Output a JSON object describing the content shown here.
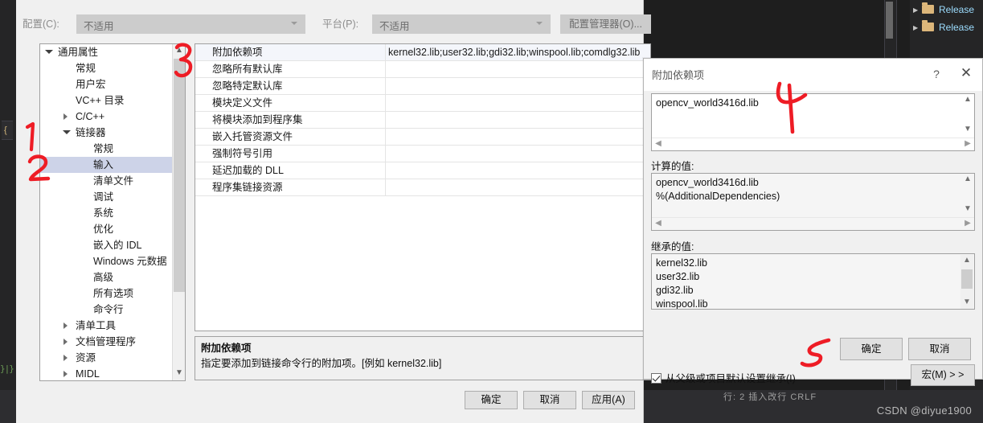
{
  "vs_shell": {
    "left_code_fragment": "}|}",
    "solution_explorer": {
      "rows": [
        {
          "label": "Release",
          "icon": "folder-icon"
        },
        {
          "label": "Release",
          "icon": "folder-icon"
        }
      ]
    },
    "status_bar_text": "行: 2    插入改行    CRLF",
    "watermark": "CSDN @diyue1900",
    "line_number": "3"
  },
  "property_pages": {
    "config": {
      "label": "配置(C):",
      "value": "不适用",
      "placeholder": "不适用"
    },
    "platform": {
      "label": "平台(P):",
      "value": "不适用",
      "placeholder": "不适用"
    },
    "config_manager_button": "配置管理器(O)...",
    "tree": {
      "items": [
        {
          "label": "通用属性",
          "indent": 0,
          "expander": "open",
          "selected": false
        },
        {
          "label": "常规",
          "indent": 1,
          "expander": "none",
          "selected": false
        },
        {
          "label": "用户宏",
          "indent": 1,
          "expander": "none",
          "selected": false
        },
        {
          "label": "VC++ 目录",
          "indent": 1,
          "expander": "none",
          "selected": false
        },
        {
          "label": "C/C++",
          "indent": 1,
          "expander": "closed",
          "selected": false
        },
        {
          "label": "链接器",
          "indent": 1,
          "expander": "open",
          "selected": false
        },
        {
          "label": "常规",
          "indent": 2,
          "expander": "none",
          "selected": false
        },
        {
          "label": "输入",
          "indent": 2,
          "expander": "none",
          "selected": true
        },
        {
          "label": "清单文件",
          "indent": 2,
          "expander": "none",
          "selected": false
        },
        {
          "label": "调试",
          "indent": 2,
          "expander": "none",
          "selected": false
        },
        {
          "label": "系统",
          "indent": 2,
          "expander": "none",
          "selected": false
        },
        {
          "label": "优化",
          "indent": 2,
          "expander": "none",
          "selected": false
        },
        {
          "label": "嵌入的 IDL",
          "indent": 2,
          "expander": "none",
          "selected": false
        },
        {
          "label": "Windows 元数据",
          "indent": 2,
          "expander": "none",
          "selected": false
        },
        {
          "label": "高级",
          "indent": 2,
          "expander": "none",
          "selected": false
        },
        {
          "label": "所有选项",
          "indent": 2,
          "expander": "none",
          "selected": false
        },
        {
          "label": "命令行",
          "indent": 2,
          "expander": "none",
          "selected": false
        },
        {
          "label": "清单工具",
          "indent": 1,
          "expander": "closed",
          "selected": false
        },
        {
          "label": "文档管理程序",
          "indent": 1,
          "expander": "closed",
          "selected": false
        },
        {
          "label": "资源",
          "indent": 1,
          "expander": "closed",
          "selected": false
        },
        {
          "label": "MIDL",
          "indent": 1,
          "expander": "closed",
          "selected": false
        }
      ]
    },
    "grid": {
      "rows": [
        {
          "name": "附加依赖项",
          "value": "kernel32.lib;user32.lib;gdi32.lib;winspool.lib;comdlg32.lib",
          "selected": true
        },
        {
          "name": "忽略所有默认库",
          "value": "",
          "selected": false
        },
        {
          "name": "忽略特定默认库",
          "value": "",
          "selected": false
        },
        {
          "name": "模块定义文件",
          "value": "",
          "selected": false
        },
        {
          "name": "将模块添加到程序集",
          "value": "",
          "selected": false
        },
        {
          "name": "嵌入托管资源文件",
          "value": "",
          "selected": false
        },
        {
          "name": "强制符号引用",
          "value": "",
          "selected": false
        },
        {
          "name": "延迟加载的 DLL",
          "value": "",
          "selected": false
        },
        {
          "name": "程序集链接资源",
          "value": "",
          "selected": false
        }
      ]
    },
    "description": {
      "title": "附加依赖项",
      "body": "指定要添加到链接命令行的附加项。[例如 kernel32.lib]"
    },
    "buttons": {
      "ok": "确定",
      "cancel": "取消",
      "apply": "应用(A)"
    }
  },
  "add_dep_dialog": {
    "title": "附加依赖项",
    "help_icon": "?",
    "close_icon": "✕",
    "editor": {
      "lines": [
        "opencv_world3416d.lib"
      ]
    },
    "evaluated": {
      "label": "计算的值:",
      "lines": [
        "opencv_world3416d.lib",
        "%(AdditionalDependencies)"
      ]
    },
    "inherited": {
      "label": "继承的值:",
      "lines": [
        "kernel32.lib",
        "user32.lib",
        "gdi32.lib",
        "winspool.lib"
      ]
    },
    "inherit_checkbox": {
      "label": "从父级或项目默认设置继承(I)",
      "checked": true
    },
    "macro_button": "宏(M)  > >",
    "buttons": {
      "ok": "确定",
      "cancel": "取消"
    }
  },
  "annotations": [
    {
      "id": "1",
      "text": "1"
    },
    {
      "id": "2",
      "text": "2"
    },
    {
      "id": "3",
      "text": "3"
    },
    {
      "id": "4",
      "text": "4"
    },
    {
      "id": "5",
      "text": "5"
    }
  ],
  "colors": {
    "annotation_red": "#ee1c25",
    "selection_blue": "#cdd3e8",
    "vs_dark_bg": "#1e1e1e",
    "dialog_bg": "#f0f0f0"
  }
}
